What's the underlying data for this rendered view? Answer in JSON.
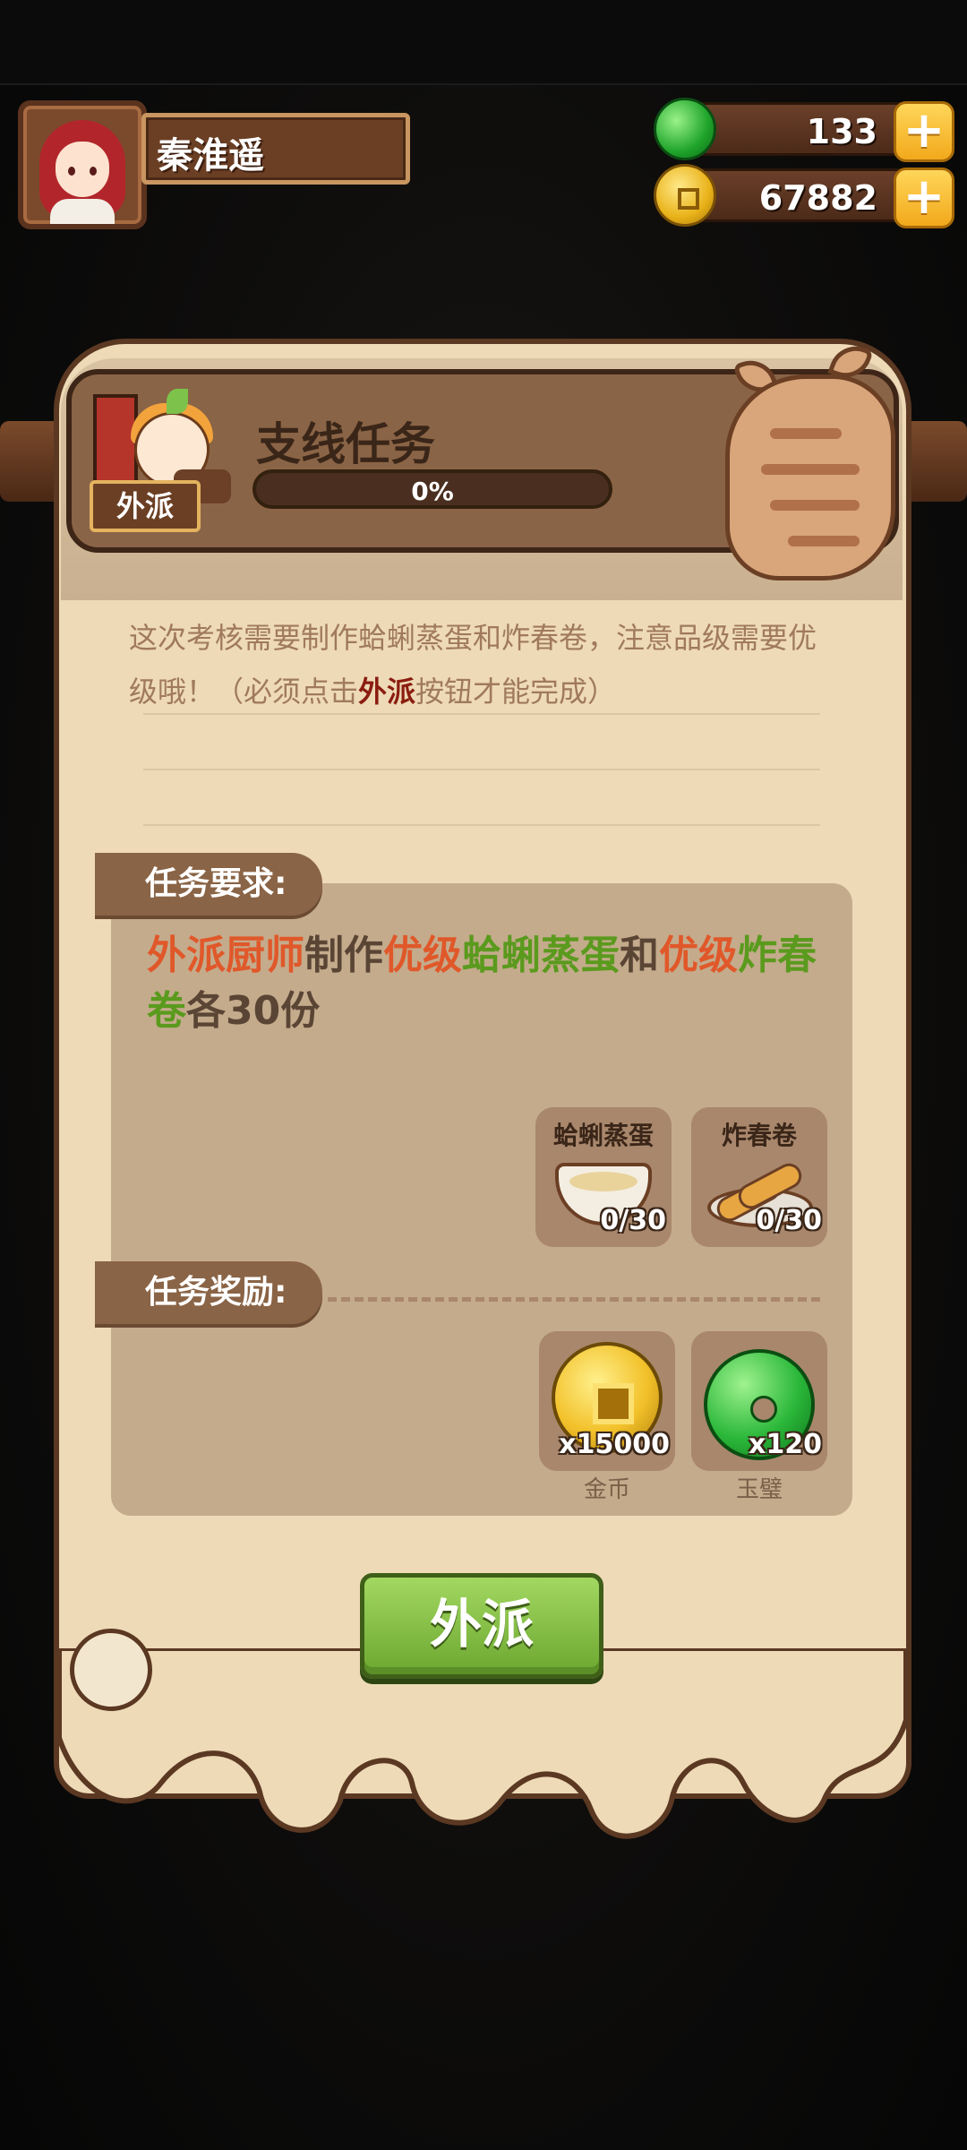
{
  "player": {
    "name": "秦淮遥",
    "jade": "133",
    "coins": "67882"
  },
  "quest": {
    "title": "支线任务",
    "progress_label": "0%",
    "progress_value": 0,
    "tag": "外派",
    "description_parts": [
      "这次考核需要制作蛤蜊蒸蛋和炸春卷，注意品级需要优级哦！（必须点击",
      "外派",
      "按钮才能完成）"
    ]
  },
  "requirements": {
    "heading": "任务要求:",
    "text_parts": [
      {
        "t": "外派厨师",
        "c": "o"
      },
      {
        "t": "制作",
        "c": "n"
      },
      {
        "t": "优级",
        "c": "o"
      },
      {
        "t": "蛤蜊蒸蛋",
        "c": "g"
      },
      {
        "t": "和",
        "c": "n"
      },
      {
        "t": "优级",
        "c": "o"
      },
      {
        "t": "炸春卷",
        "c": "g"
      },
      {
        "t": "各30份",
        "c": "n"
      }
    ],
    "items": [
      {
        "name": "蛤蜊蒸蛋",
        "count": "0/30",
        "icon": "steamed-egg-clam-icon"
      },
      {
        "name": "炸春卷",
        "count": "0/30",
        "icon": "spring-roll-icon"
      }
    ]
  },
  "rewards": {
    "heading": "任务奖励:",
    "items": [
      {
        "amount": "x15000",
        "label": "金币",
        "icon": "gold-coin-icon"
      },
      {
        "amount": "x120",
        "label": "玉璧",
        "icon": "jade-disc-icon"
      }
    ]
  },
  "actions": {
    "dispatch_label": "外派"
  },
  "colors": {
    "orange_highlight": "#e0582a",
    "green_highlight": "#5a9a1d",
    "button_green": "#6ca730",
    "panel": "#eedab7"
  }
}
